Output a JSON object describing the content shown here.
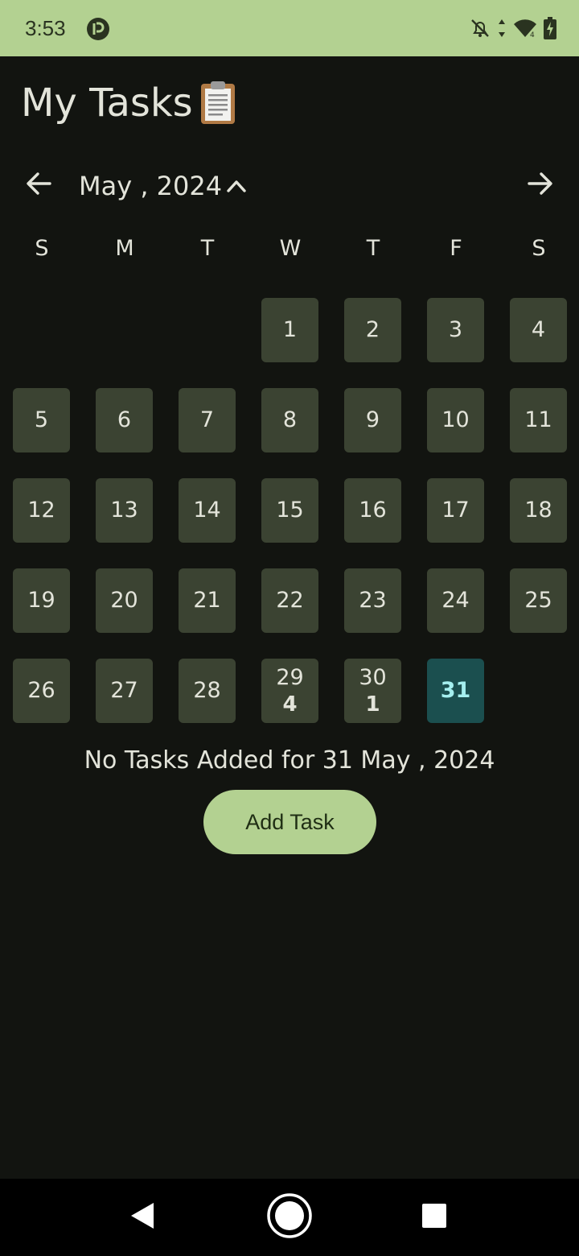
{
  "status_bar": {
    "time": "3:53",
    "icons": [
      "app-notification-icon",
      "notifications-off-icon",
      "data-arrows-icon",
      "wifi-icon",
      "battery-charging-icon"
    ]
  },
  "header": {
    "title": "My Tasks",
    "emoji_icon": "clipboard-icon"
  },
  "calendar": {
    "month_label": "May , 2024",
    "weekdays": [
      "S",
      "M",
      "T",
      "W",
      "T",
      "F",
      "S"
    ],
    "days": [
      {
        "day": "1"
      },
      {
        "day": "2"
      },
      {
        "day": "3"
      },
      {
        "day": "4"
      },
      {
        "day": "5"
      },
      {
        "day": "6"
      },
      {
        "day": "7"
      },
      {
        "day": "8"
      },
      {
        "day": "9"
      },
      {
        "day": "10"
      },
      {
        "day": "11"
      },
      {
        "day": "12"
      },
      {
        "day": "13"
      },
      {
        "day": "14"
      },
      {
        "day": "15"
      },
      {
        "day": "16"
      },
      {
        "day": "17"
      },
      {
        "day": "18"
      },
      {
        "day": "19"
      },
      {
        "day": "20"
      },
      {
        "day": "21"
      },
      {
        "day": "22"
      },
      {
        "day": "23"
      },
      {
        "day": "24"
      },
      {
        "day": "25"
      },
      {
        "day": "26"
      },
      {
        "day": "27"
      },
      {
        "day": "28"
      },
      {
        "day": "29",
        "count": "4"
      },
      {
        "day": "30",
        "count": "1"
      },
      {
        "day": "31",
        "selected": true
      }
    ]
  },
  "empty_message": "No Tasks Added for 31 May , 2024",
  "add_button_label": "Add Task",
  "colors": {
    "background": "#121410",
    "accent": "#b3d191",
    "day_cell": "#3b4332",
    "selected_day": "#1b4f4f"
  }
}
